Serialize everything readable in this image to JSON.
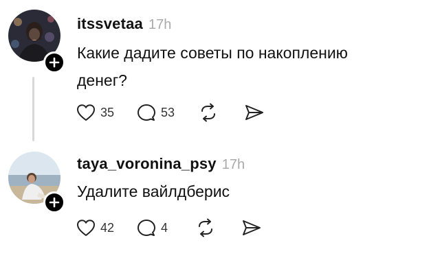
{
  "posts": [
    {
      "username": "itssvetaa",
      "time": "17h",
      "text_line1": "Какие дадите советы по накоплению",
      "text_line2": "денег?",
      "likes": "35",
      "replies": "53",
      "icons": [
        "heart-icon",
        "comment-icon",
        "repost-icon",
        "share-icon",
        "plus-icon"
      ]
    },
    {
      "username": "taya_voronina_psy",
      "time": "17h",
      "text_line1": "Удалите вайлдберис",
      "likes": "42",
      "replies": "4",
      "icons": [
        "heart-icon",
        "comment-icon",
        "repost-icon",
        "share-icon",
        "plus-icon"
      ]
    }
  ],
  "colors": {
    "text": "#111111",
    "muted": "#a9a9a9",
    "thread_line": "#d8d8d8",
    "badge": "#000000"
  }
}
